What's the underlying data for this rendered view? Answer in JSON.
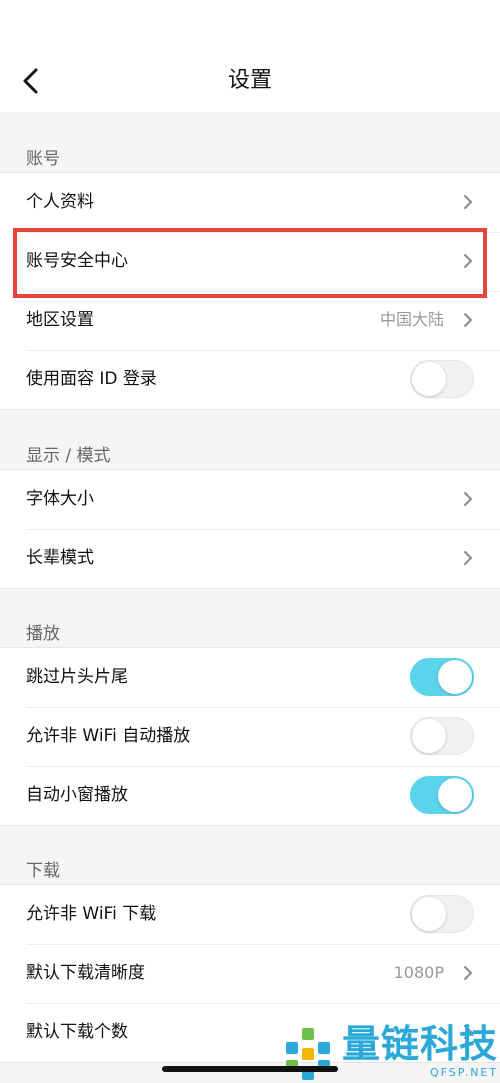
{
  "header": {
    "title": "设置"
  },
  "sections": [
    {
      "label": "账号",
      "rows": [
        {
          "label": "个人资料"
        },
        {
          "label": "账号安全中心"
        },
        {
          "label": "地区设置",
          "value": "中国大陆"
        },
        {
          "label": "使用面容 ID 登录",
          "toggle": false
        }
      ]
    },
    {
      "label": "显示 / 模式",
      "rows": [
        {
          "label": "字体大小"
        },
        {
          "label": "长辈模式"
        }
      ]
    },
    {
      "label": "播放",
      "rows": [
        {
          "label": "跳过片头片尾",
          "toggle": true
        },
        {
          "label": "允许非 WiFi 自动播放",
          "toggle": false
        },
        {
          "label": "自动小窗播放",
          "toggle": true
        }
      ]
    },
    {
      "label": "下载",
      "rows": [
        {
          "label": "允许非 WiFi 下载",
          "toggle": false
        },
        {
          "label": "默认下载清晰度",
          "value": "1080P"
        },
        {
          "label": "默认下载个数"
        }
      ]
    }
  ],
  "watermark": {
    "text": "量链科技",
    "sub": "QFSP.NET"
  },
  "colors": {
    "toggle_on": "#5bd3ea",
    "highlight": "#e2463b",
    "watermark": "#2aa8d8"
  }
}
